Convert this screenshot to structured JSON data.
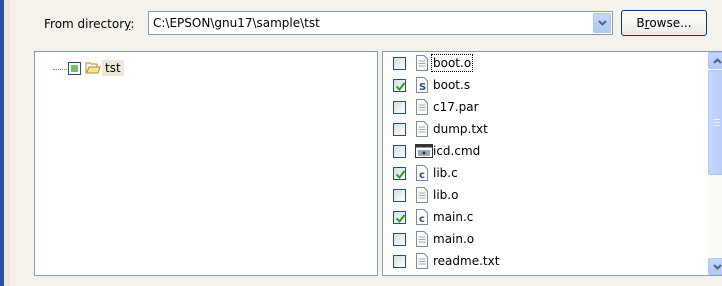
{
  "header": {
    "directory_label_prefix": "From director",
    "directory_label_mnemonic": "y",
    "directory_label_suffix": ":",
    "directory_value": "C:\\EPSON\\gnu17\\sample\\tst",
    "browse_prefix": "B",
    "browse_mnemonic": "r",
    "browse_suffix": "owse..."
  },
  "tree": {
    "root_label": "tst",
    "root_state": "partial"
  },
  "files": [
    {
      "name": "boot.o",
      "checked": false,
      "icon": "file-icon",
      "focused": true
    },
    {
      "name": "boot.s",
      "checked": true,
      "icon": "asm-source-icon"
    },
    {
      "name": "c17.par",
      "checked": false,
      "icon": "file-icon"
    },
    {
      "name": "dump.txt",
      "checked": false,
      "icon": "file-icon"
    },
    {
      "name": "icd.cmd",
      "checked": false,
      "icon": "cmd-window-icon"
    },
    {
      "name": "lib.c",
      "checked": true,
      "icon": "c-source-icon"
    },
    {
      "name": "lib.o",
      "checked": false,
      "icon": "file-icon"
    },
    {
      "name": "main.c",
      "checked": true,
      "icon": "c-source-icon"
    },
    {
      "name": "main.o",
      "checked": false,
      "icon": "file-icon"
    },
    {
      "name": "readme.txt",
      "checked": false,
      "icon": "file-icon"
    }
  ],
  "colors": {
    "check_green": "#21a121",
    "xp_blue_accent": "#2a4fa8"
  }
}
